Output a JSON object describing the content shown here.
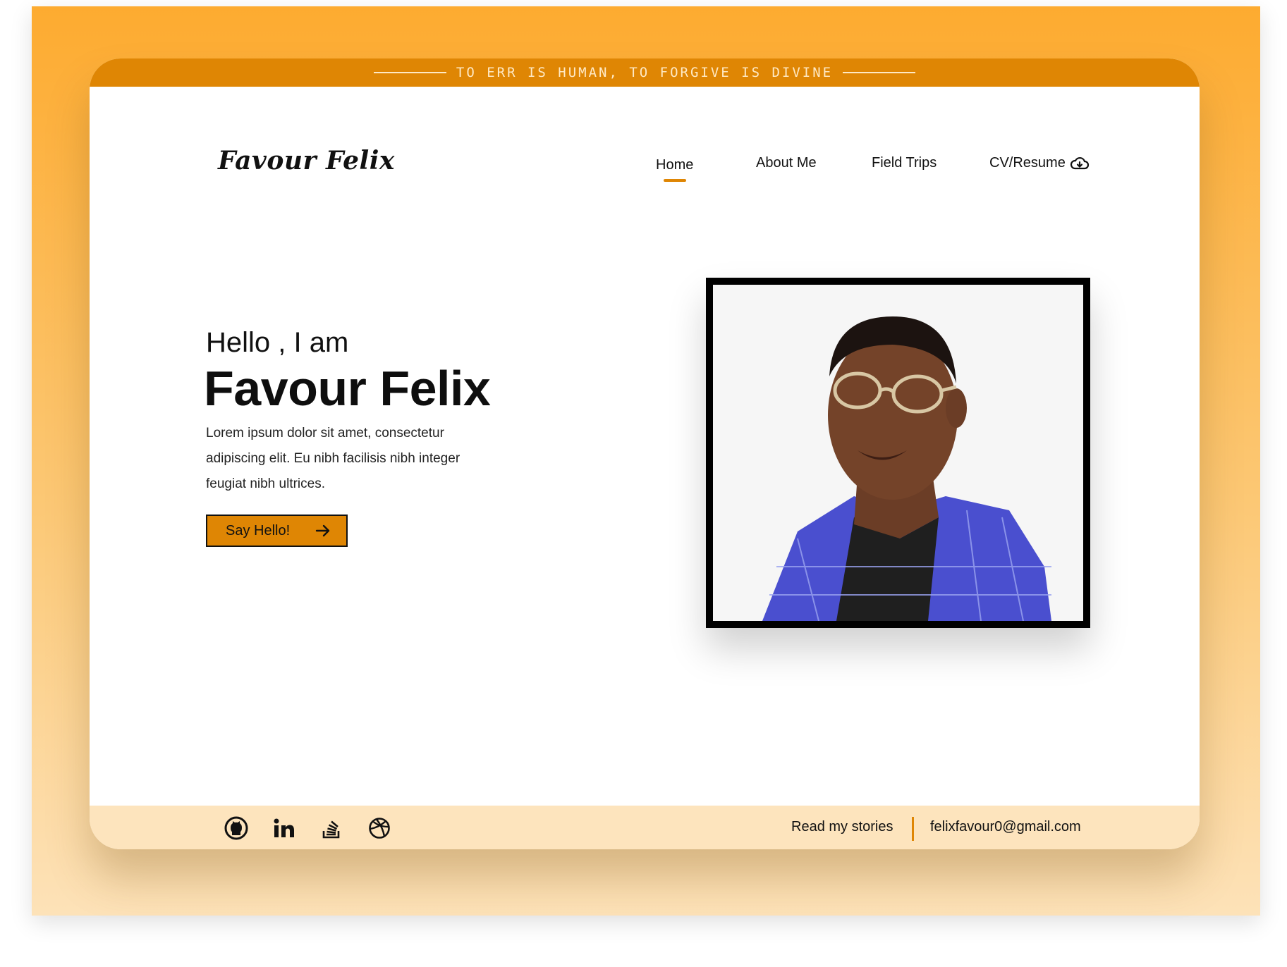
{
  "banner": {
    "quote": "TO ERR IS HUMAN, TO FORGIVE IS DIVINE"
  },
  "header": {
    "logo": "Favour Felix",
    "nav": {
      "home": "Home",
      "about": "About Me",
      "trips": "Field Trips",
      "cv": "CV/Resume"
    }
  },
  "hero": {
    "greeting": "Hello , I am",
    "name": "Favour Felix",
    "intro": "Lorem ipsum dolor sit amet, consectetur adipiscing elit. Eu nibh facilisis nibh integer feugiat nibh ultrices.",
    "cta_label": "Say Hello!"
  },
  "footer": {
    "social_icons": [
      "github-icon",
      "linkedin-icon",
      "stack-overflow-icon",
      "dribbble-icon"
    ],
    "stories_link": "Read my stories",
    "email": "felixfavour0@gmail.com"
  },
  "colors": {
    "accent": "#df8604",
    "footer_bg": "#fde4bd",
    "backdrop": "#fdab30"
  }
}
